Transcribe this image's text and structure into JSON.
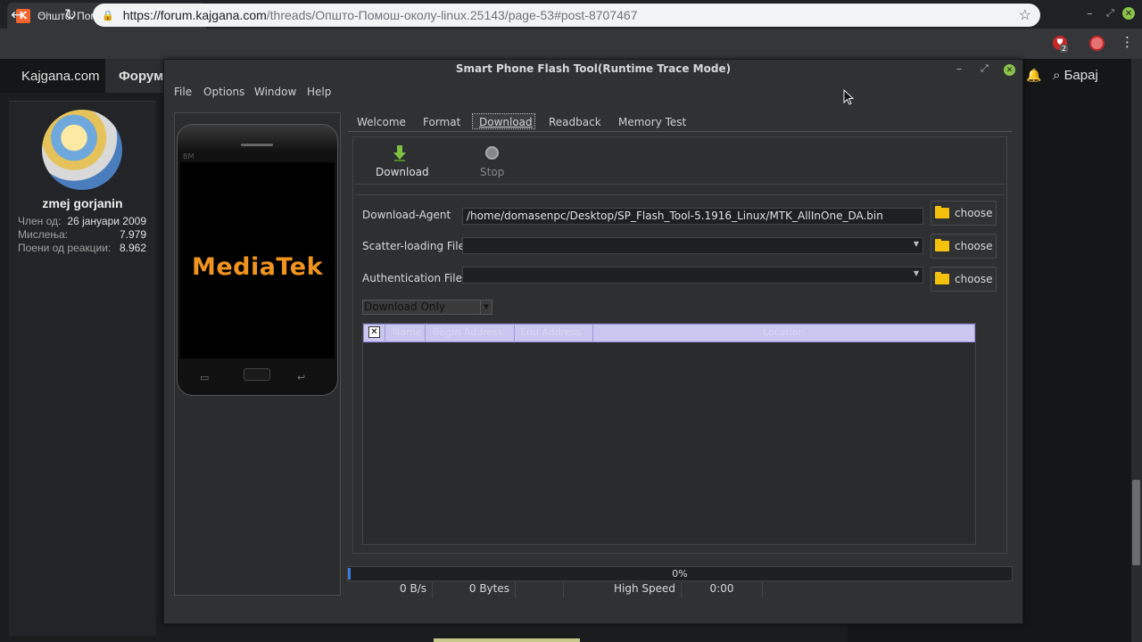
{
  "browser": {
    "tab_title": "Општо: Помош околу Linux | Ф",
    "favicon_letter": "K",
    "url_host": "https://forum.kajgana.com",
    "url_path": "/threads/Општо-Помош-околу-linux.25143/page-53#post-8707467",
    "ext_badge": "2"
  },
  "site": {
    "nav_home": "Kajgana.com",
    "nav_forum": "Форум",
    "search_label": "Барај",
    "user": {
      "name": "zmej gorjanin",
      "stats": [
        {
          "label": "Член од:",
          "value": "26 јануари 2009"
        },
        {
          "label": "Мислења:",
          "value": "7.979"
        },
        {
          "label": "Поени од реакции:",
          "value": "8.962"
        }
      ]
    }
  },
  "app": {
    "title": "Smart Phone Flash Tool(Runtime Trace Mode)",
    "menu": [
      "File",
      "Options",
      "Window",
      "Help"
    ],
    "tabs": [
      "Welcome",
      "Format",
      "Download",
      "Readback",
      "Memory Test"
    ],
    "active_tab": "Download",
    "phone_brand": "BM",
    "phone_logo": "MediaTek",
    "toolbar": {
      "download_label": "Download",
      "stop_label": "Stop"
    },
    "fields": {
      "download_agent_label": "Download-Agent",
      "download_agent_value": "/home/domasenpc/Desktop/SP_Flash_Tool-5.1916_Linux/MTK_AllInOne_DA.bin",
      "scatter_label": "Scatter-loading File",
      "scatter_value": "",
      "auth_label": "Authentication File",
      "auth_value": "",
      "choose_label": "choose"
    },
    "mode_select": "Download Only",
    "table_headers": [
      "Name",
      "Begin Address",
      "End Address",
      "Location"
    ],
    "progress": {
      "percent_text": "0%",
      "value": 0.0
    },
    "status": {
      "speed": "0 B/s",
      "bytes": "0 Bytes",
      "empty": "",
      "mode": "High Speed",
      "time": "0:00"
    }
  },
  "colors": {
    "accent": "#f0941f",
    "close_green": "#8bc34a",
    "table_header": "#c9c6f0"
  }
}
